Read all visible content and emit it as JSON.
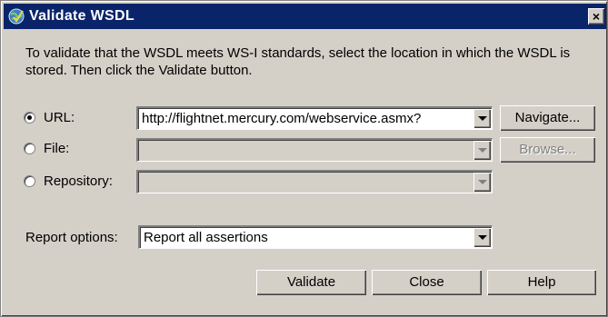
{
  "window": {
    "title": "Validate WSDL",
    "close_glyph": "×"
  },
  "description": "To validate that the WSDL meets WS-I standards, select the location in which the WSDL is stored. Then click the Validate button.",
  "source": {
    "url": {
      "label": "URL:",
      "value": "http://flightnet.mercury.com/webservice.asmx?",
      "selected": true
    },
    "file": {
      "label": "File:",
      "value": "",
      "selected": false
    },
    "repository": {
      "label": "Repository:",
      "value": "",
      "selected": false
    }
  },
  "buttons": {
    "navigate": "Navigate...",
    "browse": "Browse...",
    "validate": "Validate",
    "close": "Close",
    "help": "Help"
  },
  "report": {
    "label": "Report options:",
    "value": "Report all assertions"
  },
  "icons": {
    "title": "globe-check-icon",
    "close": "close-icon"
  }
}
